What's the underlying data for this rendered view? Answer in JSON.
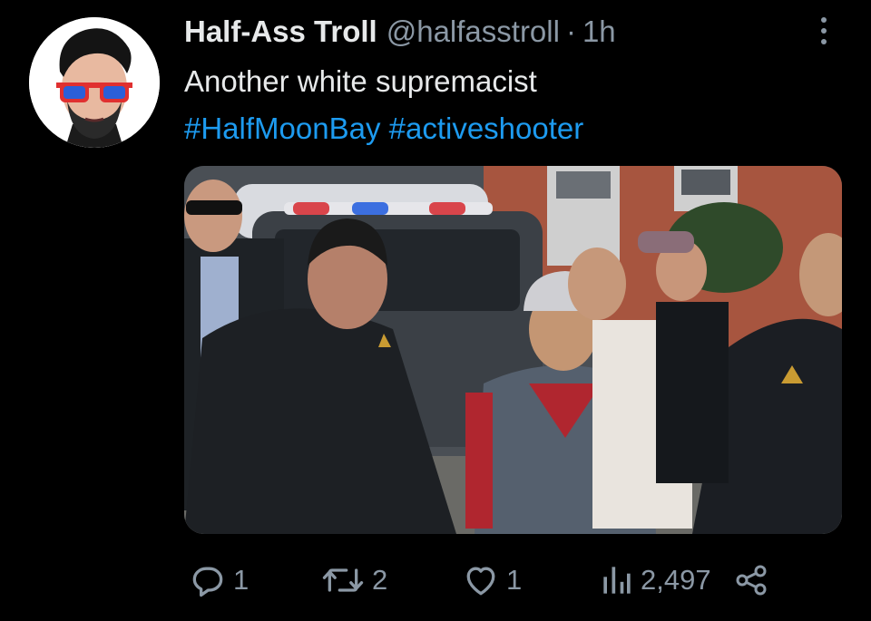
{
  "tweet": {
    "display_name": "Half-Ass Troll",
    "handle": "@halfasstroll",
    "separator": "·",
    "time": "1h",
    "text_line1": "Another white supremacist",
    "hashtags": [
      "#HalfMoonBay",
      "#activeshooter"
    ],
    "avatar_icon": "cartoon-avatar-sunglasses",
    "media_description_icon": "photo"
  },
  "actions": {
    "reply_count": "1",
    "retweet_count": "2",
    "like_count": "1",
    "views_count": "2,497"
  },
  "colors": {
    "background": "#000000",
    "text": "#e7e9ea",
    "secondary": "#8b98a5",
    "link": "#1d9bf0"
  }
}
